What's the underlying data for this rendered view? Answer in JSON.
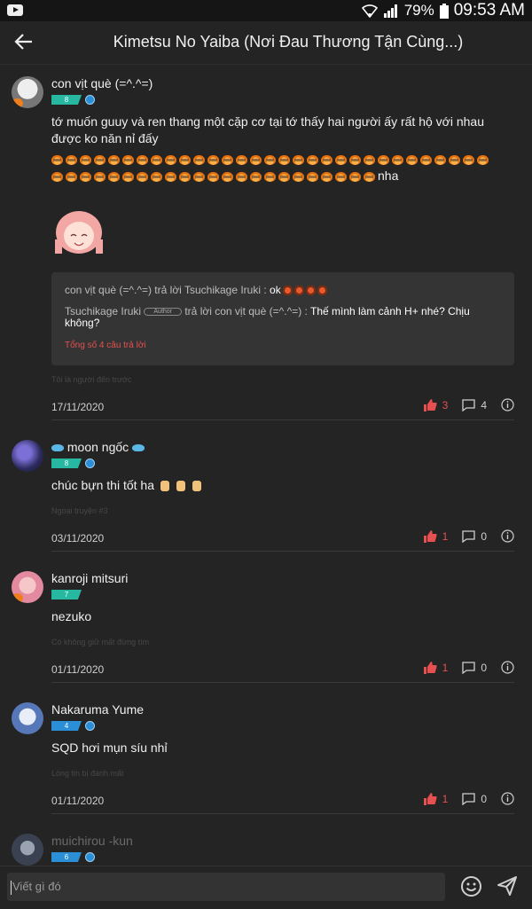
{
  "status_bar": {
    "battery": "79%",
    "time": "09:53 AM"
  },
  "header": {
    "title": "Kimetsu No Yaiba (Nơi Đau Thương Tận Cùng...)"
  },
  "comments": [
    {
      "name": "con vịt què (=^.^=)",
      "level": "8",
      "text_line1": "tớ muốn guuy và ren thang một cặp cơ tại tớ thấy hai người ấy rất hộ với nhau",
      "text_line2": "được ko năn nỉ đấy",
      "text_suffix": "nha",
      "pumpkin_count": 54,
      "replies": [
        {
          "prefix": "con vịt què (=^.^=) trả lời Tsuchikage Iruki : ",
          "text": "ok"
        },
        {
          "prefix_name": "Tsuchikage Iruki",
          "author_tag": "Author",
          "prefix_rest": " trả lời con vịt què (=^.^=) : ",
          "text": "Thế mình làm cảnh H+ nhé? Chịu không?"
        }
      ],
      "total_replies": "Tổng số 4 câu trả lời",
      "ghost": "Tôi là người đến trước",
      "date": "17/11/2020",
      "likes": "3",
      "reply_count": "4"
    },
    {
      "name": "moon ngốc",
      "level": "8",
      "text": "chúc bựn thi tốt ha",
      "ghost": "Ngoại truyện #3",
      "date": "03/11/2020",
      "likes": "1",
      "reply_count": "0"
    },
    {
      "name": "kanroji mitsuri",
      "level": "7",
      "text": "nezuko",
      "ghost": "Có không giữ mất đừng tìm",
      "date": "01/11/2020",
      "likes": "1",
      "reply_count": "0"
    },
    {
      "name": "Nakaruma Yume",
      "level": "4",
      "text": "SQD hơi mụn síu nhỉ",
      "ghost": "Lòng tin bị đánh mất",
      "date": "01/11/2020",
      "likes": "1",
      "reply_count": "0"
    },
    {
      "name": "muichirou -kun",
      "level": "6"
    }
  ],
  "composer": {
    "placeholder": "Viết gì đó"
  },
  "colors": {
    "background": "#242424",
    "like": "#e65050",
    "level_teal": "#27b8a2",
    "level_blue": "#2a8fd6"
  }
}
